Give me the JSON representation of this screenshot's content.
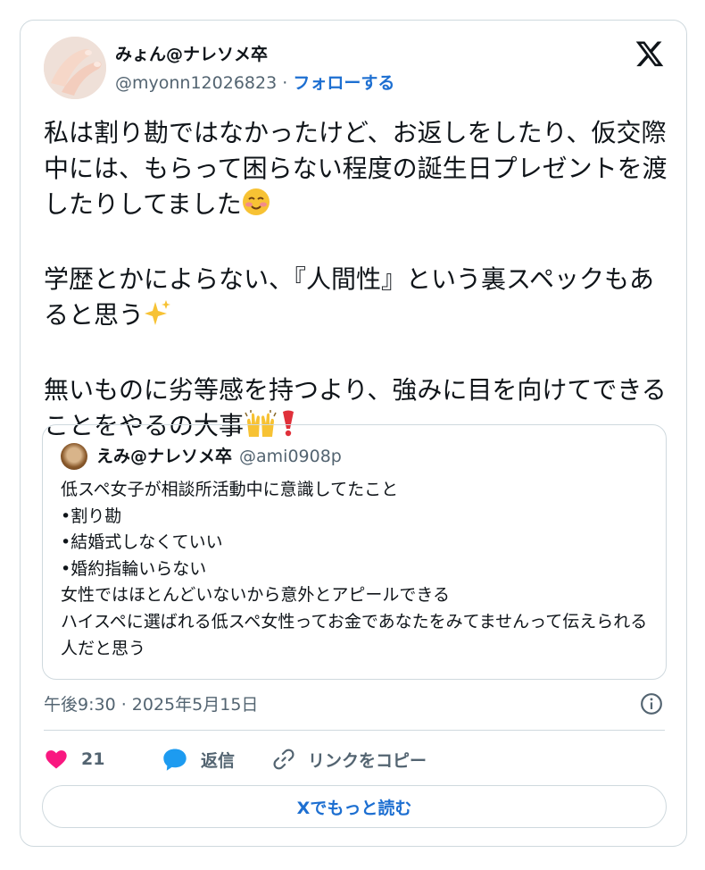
{
  "author": {
    "name": "みょん@ナレソメ卒",
    "handle": "@myonn12026823",
    "separator": "·",
    "follow_label": "フォローする"
  },
  "post": {
    "line1": "私は割り勘ではなかったけど、お返しをしたり、仮交際中には、もらって困らない程度の誕生日プレゼントを渡したりしてました",
    "line2": "学歴とかによらない、『人間性』という裏スペックもあると思う",
    "line3": "無いものに劣等感を持つより、強みに目を向けてできることをやるの大事",
    "emojis": [
      "smiling-face-with-blush",
      "sparkles",
      "raising-hands",
      "red-exclamation-mark"
    ]
  },
  "quote": {
    "name": "えみ@ナレソメ卒",
    "handle": "@ami0908p",
    "text": "低スペ女子が相談所活動中に意識してたこと\n•割り勘\n•結婚式しなくていい\n•婚約指輪いらない\n女性ではほとんどいないから意外とアピールできる\nハイスペに選ばれる低スペ女性ってお金であなたをみてませんって伝えられる人だと思う"
  },
  "timestamp": "午後9:30 · 2025年5月15日",
  "actions": {
    "like_count": "21",
    "reply_label": "返信",
    "copy_link_label": "リンクをコピー"
  },
  "more_button_label": "Xでもっと読む",
  "colors": {
    "link_blue": "#1d6fd1",
    "like_pink": "#f91880",
    "reply_blue": "#1d9bf0",
    "secondary_text": "#536471",
    "border": "#cfd9de"
  }
}
